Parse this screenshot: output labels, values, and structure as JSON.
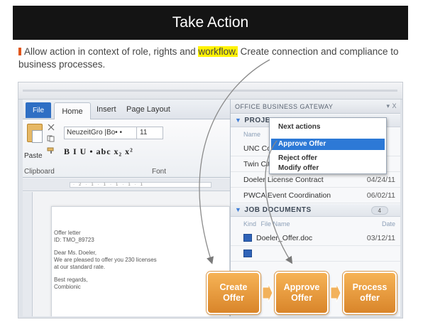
{
  "title": "Take Action",
  "intro": {
    "before": "Allow action in context of role, rights and ",
    "highlight": "workflow.",
    "after": " Create connection and compliance to business processes."
  },
  "word": {
    "tabs": [
      "File",
      "Home",
      "Insert",
      "Page Layout"
    ],
    "paste_label": "Paste",
    "font_name": "NeuzeitGro |Bo• •",
    "font_size": "11",
    "format_buttons": "B  I  U • abc x₂ x²",
    "clipboard_label": "Clipboard",
    "font_label": "Font",
    "document": {
      "line1": "Offer letter",
      "line2": "ID: TMO_89723",
      "line3": "Dear Ms. Doeler,",
      "line4": "We are pleased to offer you 230 licenses",
      "line5": "at our standard rate.",
      "line6": "Best regards,",
      "line7": "Combionic"
    }
  },
  "gateway": {
    "header": "OFFICE BUSINESS GATEWAY",
    "controls": "▾ X",
    "projects": {
      "label": "PROJEC",
      "col_name": "Name",
      "rows": [
        {
          "name": "UNC Con",
          "date": ""
        },
        {
          "name": "Twin City",
          "date": ""
        },
        {
          "name": "Doeler License Contract",
          "date": "04/24/11"
        },
        {
          "name": "PWCA Event Coordination",
          "date": "06/02/11"
        }
      ]
    },
    "documents": {
      "label": "JOB DOCUMENTS",
      "count": "4",
      "col_kind": "Kind",
      "col_file": "File Name",
      "col_date": "Date",
      "rows": [
        {
          "name": "Doeler_Offer.doc",
          "date": "03/12/11"
        }
      ]
    }
  },
  "popup": {
    "heading": "Next actions",
    "items": [
      "Approve Offer",
      "Reject offer",
      "Modify offer"
    ]
  },
  "flow": [
    "Create Offer",
    "Approve Offer",
    "Process offer"
  ],
  "colors": {
    "accent": "#e0561b",
    "highlight": "#fff200",
    "flow_orange": "#e8962f",
    "selection_blue": "#2d79d6"
  }
}
